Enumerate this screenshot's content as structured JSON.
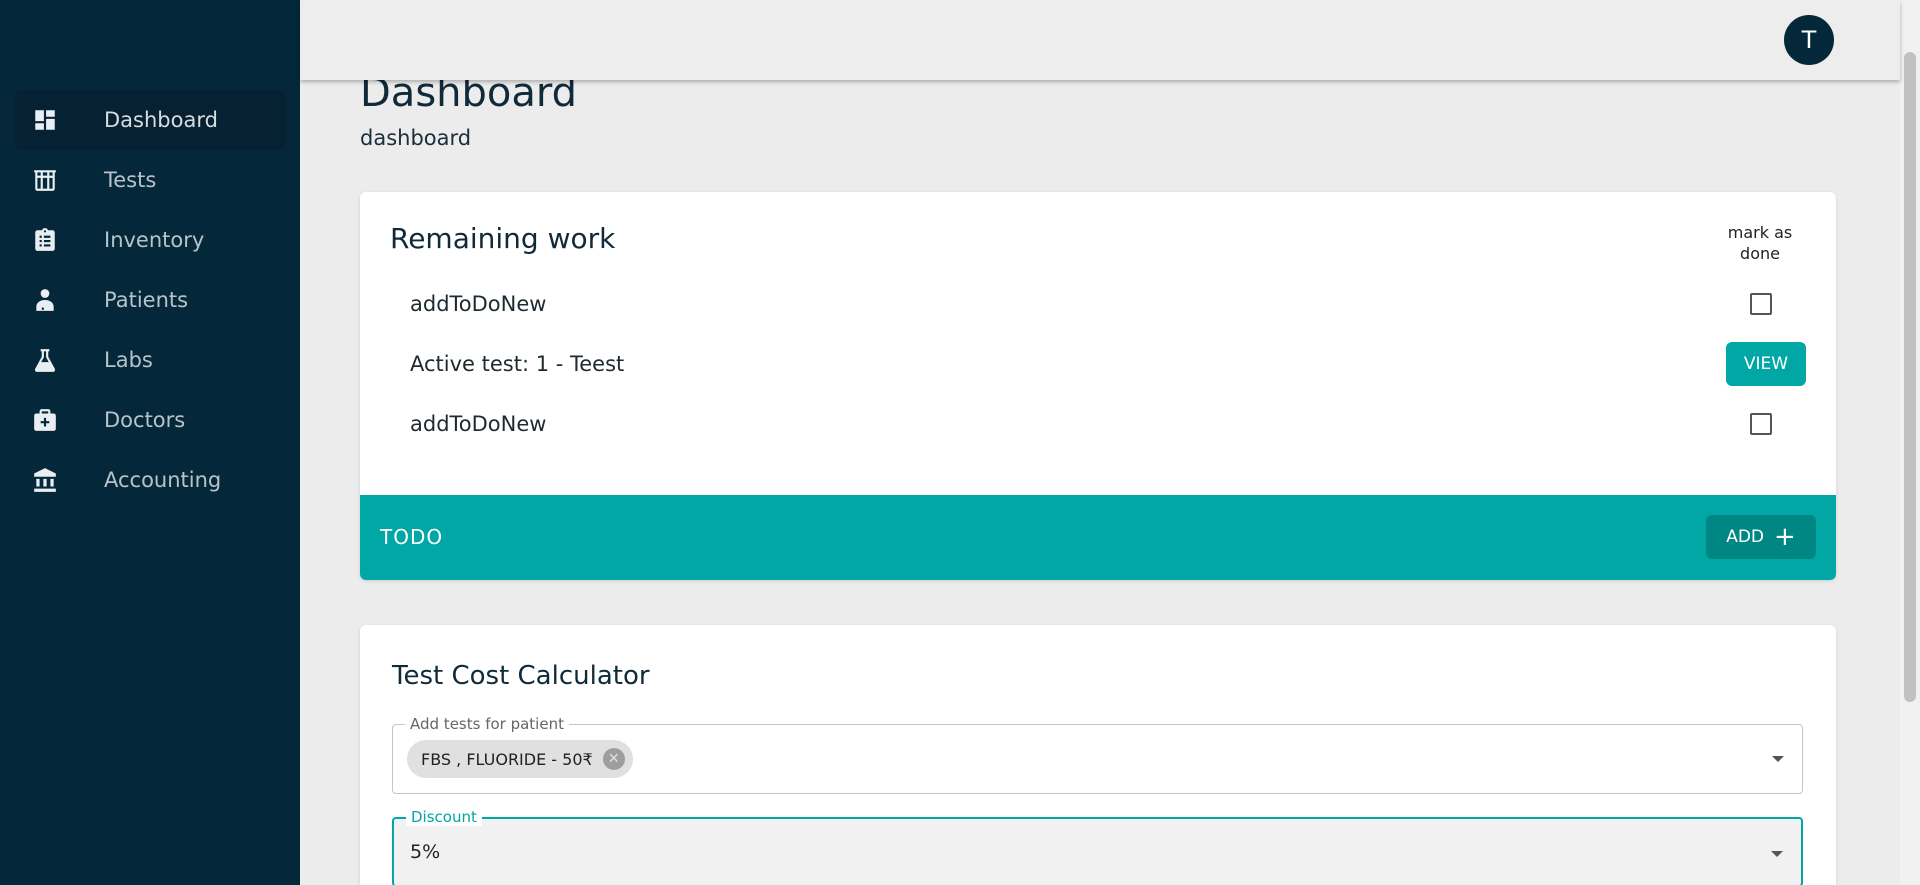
{
  "sidebar": {
    "items": [
      {
        "label": "Dashboard",
        "icon": "dashboard-icon",
        "active": true
      },
      {
        "label": "Tests",
        "icon": "test-tubes-icon"
      },
      {
        "label": "Inventory",
        "icon": "clipboard-icon"
      },
      {
        "label": "Patients",
        "icon": "patient-icon"
      },
      {
        "label": "Labs",
        "icon": "flask-icon"
      },
      {
        "label": "Doctors",
        "icon": "medical-bag-icon"
      },
      {
        "label": "Accounting",
        "icon": "bank-icon"
      }
    ]
  },
  "header": {
    "avatar_initial": "T"
  },
  "page": {
    "title": "Dashboard",
    "subtitle": "dashboard"
  },
  "remaining_work": {
    "title": "Remaining work",
    "mark_done_label": "mark as done",
    "rows": [
      {
        "text": "addToDoNew",
        "action": "checkbox"
      },
      {
        "text": "Active test: 1 - Teest",
        "action": "VIEW"
      },
      {
        "text": "addToDoNew",
        "action": "checkbox"
      }
    ],
    "todo_label": "TODO",
    "add_label": "ADD"
  },
  "calculator": {
    "title": "Test Cost Calculator",
    "tests_label": "Add tests for patient",
    "selected_test": "FBS , FLUORIDE - 50₹",
    "discount_label": "Discount",
    "discount_value": "5%"
  },
  "colors": {
    "sidebar": "#04283a",
    "accent": "#00a7a4",
    "accent_dark": "#008784"
  }
}
